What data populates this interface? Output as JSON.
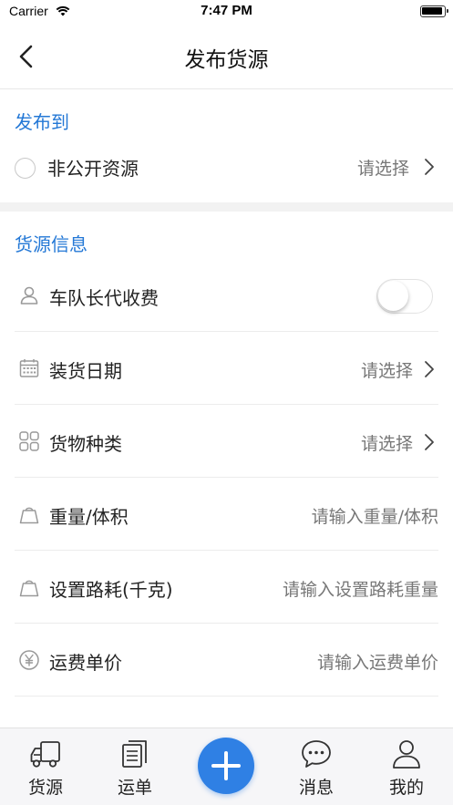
{
  "status_bar": {
    "carrier": "Carrier",
    "time": "7:47 PM"
  },
  "nav": {
    "title": "发布货源",
    "back_icon": "chevron-left-icon"
  },
  "publish_section": {
    "title": "发布到",
    "option_label": "非公开资源",
    "option_value": "请选择"
  },
  "cargo_section": {
    "title": "货源信息",
    "rows": [
      {
        "label": "车队长代收费",
        "icon": "person-icon",
        "value": ""
      },
      {
        "label": "装货日期",
        "icon": "calendar-icon",
        "value": "请选择"
      },
      {
        "label": "货物种类",
        "icon": "grid-icon",
        "value": "请选择"
      },
      {
        "label": "重量/体积",
        "icon": "weight-icon",
        "value": "请输入重量/体积"
      },
      {
        "label": "设置路耗(千克)",
        "icon": "weight-icon",
        "value": "请输入设置路耗重量"
      },
      {
        "label": "运费单价",
        "icon": "yuan-icon",
        "value": "请输入运费单价"
      }
    ]
  },
  "tab_bar": {
    "tabs": [
      {
        "label": "货源",
        "icon": "truck-icon"
      },
      {
        "label": "运单",
        "icon": "document-icon"
      },
      {
        "label": "",
        "icon": "plus-icon"
      },
      {
        "label": "消息",
        "icon": "chat-bubble-icon"
      },
      {
        "label": "我的",
        "icon": "person-icon"
      }
    ]
  },
  "colors": {
    "accent": "#2478d6",
    "add_button": "#2f80e4"
  }
}
